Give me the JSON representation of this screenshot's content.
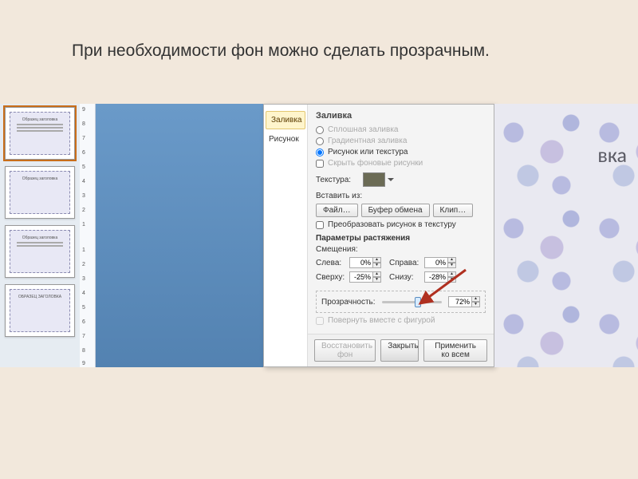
{
  "page": {
    "title": "При необходимости фон можно сделать прозрачным."
  },
  "thumbs": {
    "t1": "Образец заголовка",
    "t2": "Образец заголовка",
    "t3": "Образец заголовка",
    "t4": "ОБРАЗЕЦ ЗАГОЛОВКА"
  },
  "dialog": {
    "tabs": {
      "fill": "Заливка",
      "picture": "Рисунок"
    },
    "heading": "Заливка",
    "radio_solid": "Сплошная заливка",
    "radio_gradient": "Градиентная заливка",
    "radio_picture": "Рисунок или текстура",
    "chk_hidebg": "Скрыть фоновые рисунки",
    "texture_label": "Текстура:",
    "insert_from": "Вставить из:",
    "btn_file": "Файл…",
    "btn_clip": "Буфер обмена",
    "btn_clipart": "Клип…",
    "chk_tile": "Преобразовать рисунок в текстуру",
    "stretch_header": "Параметры растяжения",
    "offsets_label": "Смещения:",
    "left": "Слева:",
    "left_v": "0%",
    "right": "Справа:",
    "right_v": "0%",
    "top": "Сверху:",
    "top_v": "-25%",
    "bottom": "Снизу:",
    "bottom_v": "-28%",
    "transparency": "Прозрачность:",
    "transparency_v": "72%",
    "chk_rotate": "Повернуть вместе с фигурой",
    "btn_restore": "Восстановить фон",
    "btn_close": "Закрыть",
    "btn_applyall": "Применить ко всем"
  },
  "floral": {
    "title_fragment": "вка"
  },
  "ruler_marks": [
    "9",
    "8",
    "7",
    "6",
    "5",
    "4",
    "3",
    "2",
    "1",
    "1",
    "2",
    "3",
    "4",
    "5",
    "6",
    "7",
    "8",
    "9"
  ]
}
